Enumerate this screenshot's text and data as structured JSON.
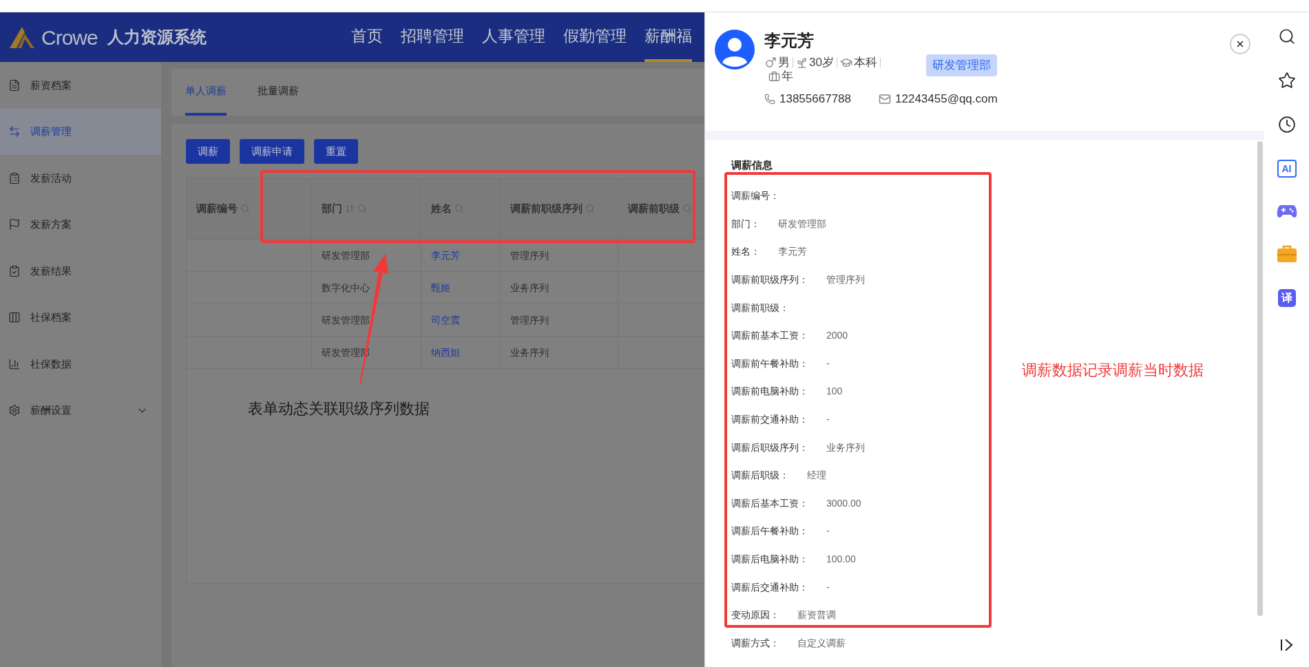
{
  "header": {
    "logo_text": "Crowe",
    "system_title": "人力资源系统",
    "nav": [
      {
        "label": "首页",
        "selected": false
      },
      {
        "label": "招聘管理",
        "selected": false
      },
      {
        "label": "人事管理",
        "selected": false
      },
      {
        "label": "假勤管理",
        "selected": false
      },
      {
        "label": "薪酬福",
        "selected": true
      }
    ]
  },
  "sidebar": {
    "items": [
      {
        "label": "薪资档案",
        "selected": false,
        "expandable": false
      },
      {
        "label": "调薪管理",
        "selected": true,
        "expandable": false
      },
      {
        "label": "发薪活动",
        "selected": false,
        "expandable": false
      },
      {
        "label": "发薪方案",
        "selected": false,
        "expandable": false
      },
      {
        "label": "发薪结果",
        "selected": false,
        "expandable": false
      },
      {
        "label": "社保档案",
        "selected": false,
        "expandable": false
      },
      {
        "label": "社保数据",
        "selected": false,
        "expandable": false
      },
      {
        "label": "薪酬设置",
        "selected": false,
        "expandable": true
      }
    ]
  },
  "tabs": [
    {
      "label": "单人调薪",
      "selected": true
    },
    {
      "label": "批量调薪",
      "selected": false
    }
  ],
  "buttons": [
    "调薪",
    "调薪申请",
    "重置"
  ],
  "table": {
    "columns": [
      {
        "label": "调薪编号",
        "sortable": false
      },
      {
        "label": "部门",
        "sortable": true
      },
      {
        "label": "姓名",
        "sortable": false
      },
      {
        "label": "调薪前职级序列",
        "sortable": false
      },
      {
        "label": "调薪前职级",
        "sortable": false
      }
    ],
    "rows": [
      {
        "department": "研发管理部",
        "name": "李元芳",
        "grade_sequence": "管理序列"
      },
      {
        "department": "数字化中心",
        "name": "甄姬",
        "grade_sequence": "业务序列"
      },
      {
        "department": "研发管理部",
        "name": "司空震",
        "grade_sequence": "管理序列"
      },
      {
        "department": "研发管理部",
        "name": "纳西妲",
        "grade_sequence": "业务序列"
      }
    ]
  },
  "drawer": {
    "name": "李元芳",
    "gender": "男",
    "age": "30岁",
    "education": "本科",
    "tenure": "年",
    "department_tag": "研发管理部",
    "phone": "13855667788",
    "email": "12243455@qq.com",
    "section_title": "调薪信息",
    "fields": [
      {
        "label": "调薪编号："
      },
      {
        "label": "部门：",
        "value": "研发管理部"
      },
      {
        "label": "姓名：",
        "value": "李元芳"
      },
      {
        "label": "调薪前职级序列：",
        "value": "管理序列"
      },
      {
        "label": "调薪前职级："
      },
      {
        "label": "调薪前基本工资：",
        "value": "2000"
      },
      {
        "label": "调薪前午餐补助：",
        "value": "-"
      },
      {
        "label": "调薪前电脑补助：",
        "value": "100"
      },
      {
        "label": "调薪前交通补助：",
        "value": "-"
      },
      {
        "label": "调薪后职级序列：",
        "value": "业务序列"
      },
      {
        "label": "调薪后职级：",
        "value": "经理"
      },
      {
        "label": "调薪后基本工资：",
        "value": "3000.00"
      },
      {
        "label": "调薪后午餐补助：",
        "value": "-"
      },
      {
        "label": "调薪后电脑补助：",
        "value": "100.00"
      },
      {
        "label": "调薪后交通补助：",
        "value": "-"
      },
      {
        "label": "变动原因：",
        "value": "薪资普调"
      },
      {
        "label": "调薪方式：",
        "value": "自定义调薪"
      }
    ]
  },
  "browser_toolbar": {
    "ai_badge": "AI",
    "translate_badge": "译"
  },
  "annotations": {
    "table_note": "表单动态关联职级序列数据",
    "drawer_note": "调薪数据记录调薪当时数据"
  }
}
